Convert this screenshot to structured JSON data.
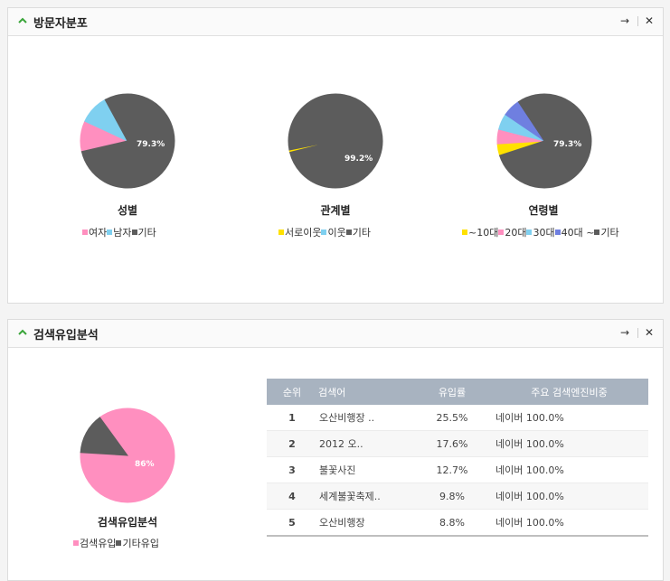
{
  "visitor_panel": {
    "title": "방문자분포",
    "charts": [
      {
        "title": "성별",
        "pct_label": "79.3%",
        "slices": [
          {
            "name": "여자",
            "value": 10.5,
            "color": "#ff8fbf"
          },
          {
            "name": "남자",
            "value": 10.2,
            "color": "#7fd0f0"
          },
          {
            "name": "기타",
            "value": 79.3,
            "color": "#5c5c5c"
          }
        ]
      },
      {
        "title": "관계별",
        "pct_label": "99.2%",
        "slices": [
          {
            "name": "서로이웃",
            "value": 0.8,
            "color": "#ffe100"
          },
          {
            "name": "이웃",
            "value": 0.0,
            "color": "#7fd0f0"
          },
          {
            "name": "기타",
            "value": 99.2,
            "color": "#5c5c5c"
          }
        ]
      },
      {
        "title": "연령별",
        "pct_label": "79.3%",
        "slices": [
          {
            "name": "~10대",
            "value": 4.0,
            "color": "#ffe100"
          },
          {
            "name": "20대",
            "value": 5.0,
            "color": "#ff8fbf"
          },
          {
            "name": "30대",
            "value": 5.5,
            "color": "#7fd0f0"
          },
          {
            "name": "40대 ~",
            "value": 6.2,
            "color": "#6f7fe0"
          },
          {
            "name": "기타",
            "value": 79.3,
            "color": "#5c5c5c"
          }
        ]
      }
    ]
  },
  "search_panel": {
    "title": "검색유입분석",
    "chart": {
      "title": "검색유입분석",
      "pct_label": "86%",
      "slices": [
        {
          "name": "검색유입",
          "value": 86,
          "color": "#ff8fbf"
        },
        {
          "name": "기타유입",
          "value": 14,
          "color": "#5c5c5c"
        }
      ]
    },
    "table": {
      "headers": [
        "순위",
        "검색어",
        "유입률",
        "주요 검색엔진비중"
      ],
      "rows": [
        {
          "rank": "1",
          "keyword": "오산비행장 ..",
          "rate": "25.5%",
          "share": "네이버 100.0%"
        },
        {
          "rank": "2",
          "keyword": "2012 오..",
          "rate": "17.6%",
          "share": "네이버 100.0%"
        },
        {
          "rank": "3",
          "keyword": "불꽃사진",
          "rate": "12.7%",
          "share": "네이버 100.0%"
        },
        {
          "rank": "4",
          "keyword": "세계불꽃축제..",
          "rate": "9.8%",
          "share": "네이버 100.0%"
        },
        {
          "rank": "5",
          "keyword": "오산비행장",
          "rate": "8.8%",
          "share": "네이버 100.0%"
        }
      ]
    }
  },
  "buttons": {
    "go": "→",
    "close": "✕"
  },
  "chart_data": [
    {
      "type": "pie",
      "title": "성별",
      "categories": [
        "여자",
        "남자",
        "기타"
      ],
      "values": [
        10.5,
        10.2,
        79.3
      ]
    },
    {
      "type": "pie",
      "title": "관계별",
      "categories": [
        "서로이웃",
        "이웃",
        "기타"
      ],
      "values": [
        0.8,
        0.0,
        99.2
      ]
    },
    {
      "type": "pie",
      "title": "연령별",
      "categories": [
        "~10대",
        "20대",
        "30대",
        "40대 ~",
        "기타"
      ],
      "values": [
        4.0,
        5.0,
        5.5,
        6.2,
        79.3
      ]
    },
    {
      "type": "pie",
      "title": "검색유입분석",
      "categories": [
        "검색유입",
        "기타유입"
      ],
      "values": [
        86,
        14
      ]
    }
  ]
}
